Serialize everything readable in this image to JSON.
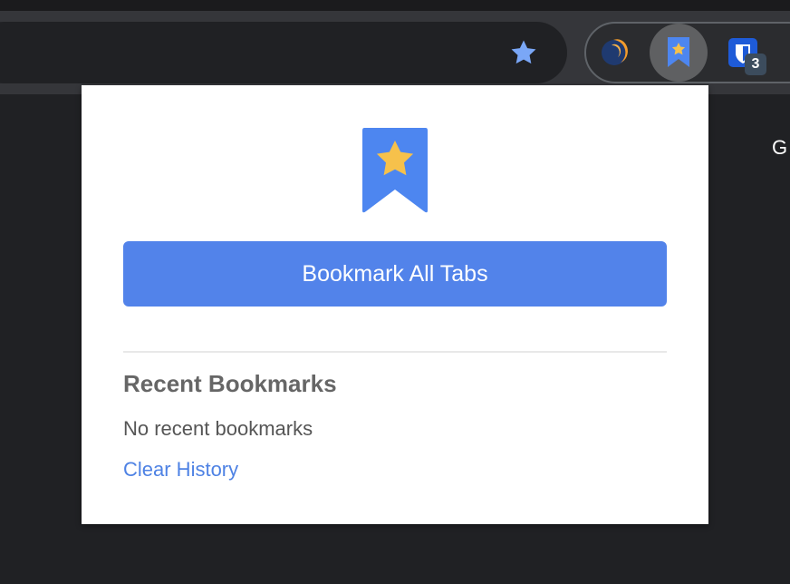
{
  "browser": {
    "bookmark_star_icon": "star-icon",
    "extensions": [
      {
        "name": "orange-crescent-extension-icon",
        "active": false
      },
      {
        "name": "bookmark-all-tabs-extension-icon",
        "active": true
      },
      {
        "name": "shield-extension-icon",
        "badge": "3",
        "active": false
      }
    ],
    "partial_right_text": "G"
  },
  "popup": {
    "logo_icon": "bookmark-ribbon-star-icon",
    "bookmark_all_button": "Bookmark All Tabs",
    "recent_title": "Recent Bookmarks",
    "empty_message": "No recent bookmarks",
    "clear_history_link": "Clear History"
  },
  "colors": {
    "accent_blue": "#5283ea",
    "star_yellow": "#f6c14b",
    "link_blue": "#4e82e4",
    "background_dark": "#202124"
  }
}
